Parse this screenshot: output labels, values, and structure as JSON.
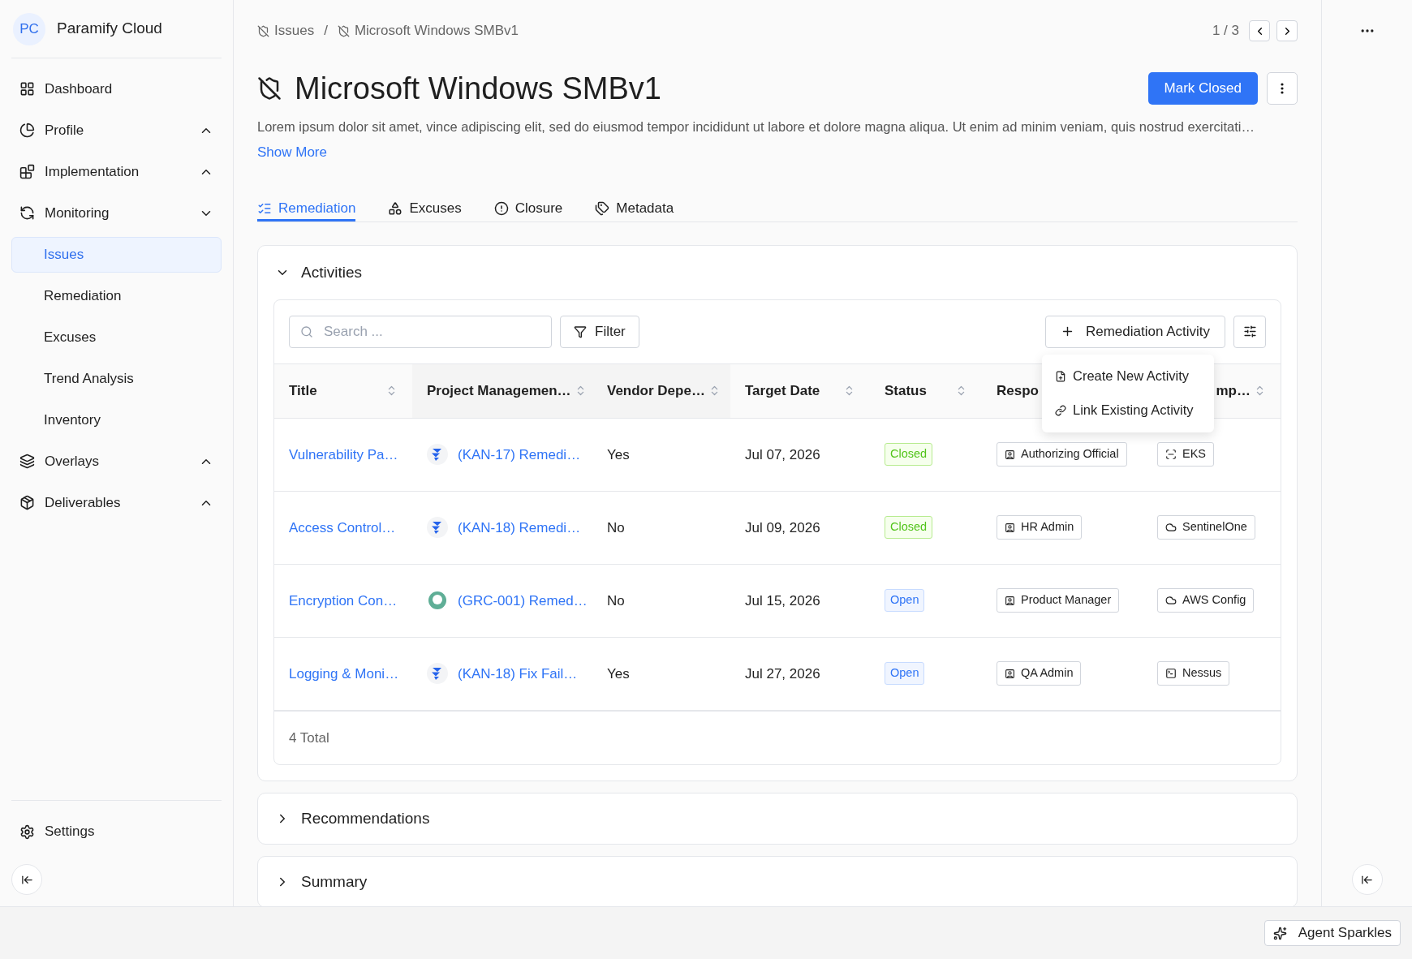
{
  "sidebar": {
    "brand": {
      "initials": "PC",
      "name": "Paramify Cloud"
    },
    "items": [
      {
        "label": "Dashboard",
        "selected": false
      },
      {
        "label": "Profile",
        "selected": false,
        "expanded": false
      },
      {
        "label": "Implementation",
        "selected": false,
        "expanded": false
      },
      {
        "label": "Monitoring",
        "selected": false,
        "expanded": true,
        "children": [
          {
            "label": "Issues",
            "selected": true
          },
          {
            "label": "Remediation",
            "selected": false
          },
          {
            "label": "Excuses",
            "selected": false
          },
          {
            "label": "Trend Analysis",
            "selected": false
          },
          {
            "label": "Inventory",
            "selected": false
          }
        ]
      },
      {
        "label": "Overlays",
        "selected": false,
        "expanded": false
      },
      {
        "label": "Deliverables",
        "selected": false,
        "expanded": false
      }
    ],
    "settings": "Settings"
  },
  "breadcrumb": [
    "Issues",
    "Microsoft Windows SMBv1"
  ],
  "breadcrumb_separator": "/",
  "pager": "1 / 3",
  "title": "Microsoft Windows SMBv1",
  "primary_button": "Mark Closed",
  "description": "Lorem ipsum dolor sit amet, vince adipiscing elit, sed do eiusmod tempor incididunt ut labore et dolore magna aliqua. Ut enim ad  minim veniam, quis nostrud exercitati…",
  "show_more": "Show More",
  "tabs": [
    {
      "label": "Remediation",
      "selected": true
    },
    {
      "label": "Excuses",
      "selected": false
    },
    {
      "label": "Closure",
      "selected": false
    },
    {
      "label": "Metadata",
      "selected": false
    }
  ],
  "activities": {
    "title": "Activities",
    "expanded": true,
    "search": {
      "placeholder": "Search ..."
    },
    "filter": "Filter",
    "add_button": "Remediation Activity",
    "menu": [
      "Create New Activity",
      "Link Existing Activity"
    ],
    "columns": [
      "Title",
      "Project Managemen…",
      "Vendor Depe…",
      "Target Date",
      "Status",
      "Respo",
      "mp…"
    ],
    "rows": [
      {
        "title": "Vulnerability Pa…",
        "pm": {
          "kind": "jira",
          "text": "(KAN-17) Remedi…"
        },
        "vendor": "Yes",
        "date": "Jul 07, 2026",
        "status": {
          "kind": "closed",
          "label": "Closed"
        },
        "role": "Authorizing Official",
        "component": {
          "kind": "chip",
          "text": "EKS"
        }
      },
      {
        "title": "Access Control…",
        "pm": {
          "kind": "jira",
          "text": "(KAN-18) Remedi…"
        },
        "vendor": "No",
        "date": "Jul 09, 2026",
        "status": {
          "kind": "closed",
          "label": "Closed"
        },
        "role": "HR Admin",
        "component": {
          "kind": "cloud",
          "text": "SentinelOne"
        }
      },
      {
        "title": "Encryption Con…",
        "pm": {
          "kind": "grc",
          "text": "(GRC-001) Remed…"
        },
        "vendor": "No",
        "date": "Jul 15, 2026",
        "status": {
          "kind": "open",
          "label": "Open"
        },
        "role": "Product Manager",
        "component": {
          "kind": "cloud",
          "text": "AWS Config"
        }
      },
      {
        "title": "Logging & Moni…",
        "pm": {
          "kind": "jira",
          "text": "(KAN-18) Fix Fail…"
        },
        "vendor": "Yes",
        "date": "Jul 27, 2026",
        "status": {
          "kind": "open",
          "label": "Open"
        },
        "role": "QA Admin",
        "component": {
          "kind": "terminal",
          "text": "Nessus"
        }
      }
    ],
    "total": "4 Total"
  },
  "sections": [
    {
      "title": "Recommendations",
      "expanded": false
    },
    {
      "title": "Summary",
      "expanded": false
    }
  ],
  "agent_button": "Agent Sparkles"
}
